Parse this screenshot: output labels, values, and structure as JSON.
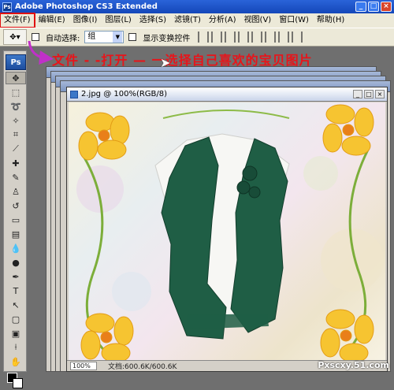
{
  "app": {
    "title": "Adobe Photoshop CS3 Extended",
    "icon_label": "Ps"
  },
  "menu": [
    {
      "label": "文件(F)",
      "highlight": true
    },
    {
      "label": "编辑(E)"
    },
    {
      "label": "图像(I)"
    },
    {
      "label": "图层(L)"
    },
    {
      "label": "选择(S)"
    },
    {
      "label": "滤镜(T)"
    },
    {
      "label": "分析(A)"
    },
    {
      "label": "视图(V)"
    },
    {
      "label": "窗口(W)"
    },
    {
      "label": "帮助(H)"
    }
  ],
  "options_bar": {
    "auto_select_label": "自动选择:",
    "auto_select_value": "组",
    "show_transform_label": "显示变换控件"
  },
  "annotation": {
    "text": "文件 - -打开 — 一选择自己喜欢的宝贝图片",
    "color": "#e8141a"
  },
  "toolbox": {
    "logo": "Ps"
  },
  "document": {
    "title": "2.jpg @ 100%(RGB/8)",
    "zoom": "100%",
    "doc_size": "文档:600.6K/600.6K"
  },
  "watermark": "Pxscxy.51.com",
  "colors": {
    "accent": "#e8141a",
    "vest": "#1f5e45",
    "flower": "#f6c431"
  }
}
